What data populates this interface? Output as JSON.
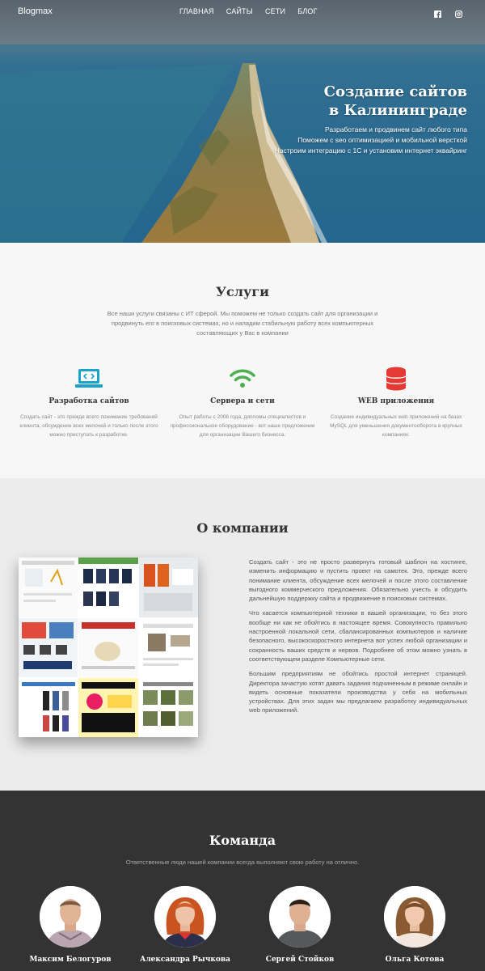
{
  "nav": {
    "brand": "Blogmax",
    "items": [
      "ГЛАВНАЯ",
      "САЙТЫ",
      "СЕТИ",
      "БЛОГ"
    ],
    "social": [
      "facebook-icon",
      "instagram-icon"
    ]
  },
  "hero": {
    "title_line1": "Создание сайтов",
    "title_line2": "в Калининграде",
    "sub1": "Разработаем и продвинем сайт любого типа",
    "sub2": "Поможем с seo оптимизацией и мобильной версткой",
    "sub3": "Настроим интеграцию с 1С и установим интернет эквайринг"
  },
  "services": {
    "title": "Услуги",
    "intro": "Все наши услуги связаны с ИТ сферой. Мы поможем не только создать сайт для организации и продвинуть его в поисковых системах, но и наладим стабильную работу всех компьютерных составляющих у Вас в компании",
    "items": [
      {
        "name": "Разработка сайтов",
        "desc": "Создать сайт - это прежде всего понимание требований клиента, обсуждение всех мелочей и только после этого можно приступать к разработке.",
        "icon": "laptop-code-icon",
        "color": "#1aa3c8"
      },
      {
        "name": "Сервера и сети",
        "desc": "Опыт работы с 2008 года, дипломы специалистов и профессиональное оборудование - вот наше предложение для организации Вашего бизнесса.",
        "icon": "wifi-icon",
        "color": "#4caf50"
      },
      {
        "name": "WEB приложения",
        "desc": "Создание индивидуальных web приложений на базах MySQL для уменьшения документооборота в крупных компаниях.",
        "icon": "database-icon",
        "color": "#e53935"
      }
    ]
  },
  "about": {
    "title": "О компании",
    "paragraphs": [
      "Создать сайт - это не просто развернуть готовый шаблон на хостинге, изменить информацию и пустить проект на самотек. Это, прежде всего понимание клиента, обсуждение всех мелочей и после этого составление выгодного коммерческого предложения. Обязательно учесть и обсудить дальнейшую поддержку сайта и продвижение в поисковых системах.",
      "Что касается компьютерной техники в вашей организации, то без этого вообще ни как не обойтись в настоящее время. Совокупность правильно настроенной локальной сети, сбалансированных компьютеров и наличие безопасного, высокоскоростного интернета вот успех любой организации и сохранность ваших средств и нервов. Подробнее об этом можно узнать в соответствующем разделе Компьютерные сети.",
      "Большим предприятиям не обойтись простой интернет страницей. Директора зачастую хотят давать задания подчиненным в режиме онлайн и видеть основные показатели производства у себя на мобильных устройствах. Для этих задач мы предлагаем разработку индивидуальных web приложений."
    ]
  },
  "team": {
    "title": "Команда",
    "intro": "Ответственные люди нашей компании всегда выполняют свою работу на отлично.",
    "members": [
      {
        "name": "Максим Белогуров"
      },
      {
        "name": "Александра Рычкова"
      },
      {
        "name": "Сергей Стойков"
      },
      {
        "name": "Ольга Котова"
      }
    ]
  }
}
